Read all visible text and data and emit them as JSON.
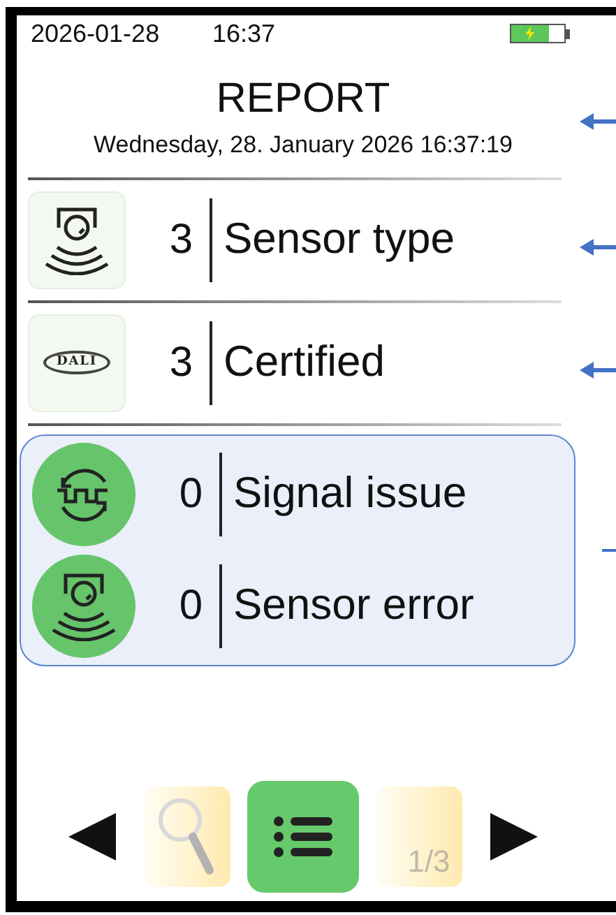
{
  "status_bar": {
    "date": "2026-01-28",
    "time": "16:37",
    "battery": {
      "charging": true
    }
  },
  "header": {
    "title": "REPORT",
    "subtitle": "Wednesday, 28. January 2026 16:37:19"
  },
  "rows": [
    {
      "kind": "sensor",
      "count": "3",
      "label": "Sensor type"
    },
    {
      "kind": "dali",
      "logo_text": "DALI",
      "count": "3",
      "label": "Certified"
    }
  ],
  "group": {
    "rows": [
      {
        "kind": "signal",
        "count": "0",
        "label": "Signal issue"
      },
      {
        "kind": "sensor",
        "count": "0",
        "label": "Sensor error"
      }
    ]
  },
  "nav": {
    "tabs": [
      {
        "kind": "search",
        "selected": false
      },
      {
        "kind": "list",
        "selected": true
      },
      {
        "kind": "pages",
        "page": "1/3",
        "selected": false
      }
    ]
  }
}
